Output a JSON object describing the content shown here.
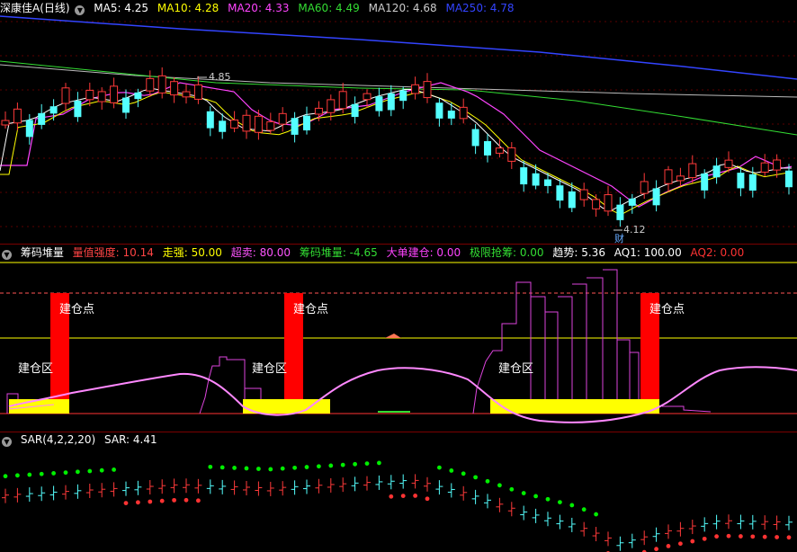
{
  "main": {
    "stock_name": "深康佳A",
    "period": "(日线)",
    "ma": [
      {
        "label": "MA5: 4.25",
        "color": "#ffffff"
      },
      {
        "label": "MA10: 4.28",
        "color": "#ffff00"
      },
      {
        "label": "MA20: 4.33",
        "color": "#ff44ff"
      },
      {
        "label": "MA60: 4.49",
        "color": "#33dd33"
      },
      {
        "label": "MA120: 4.68",
        "color": "#cccccc"
      },
      {
        "label": "MA250: 4.78",
        "color": "#3344ff"
      }
    ],
    "high_marker": "4.85",
    "low_marker": "4.12",
    "finance_badge": "财"
  },
  "indicator": {
    "name": "筹码堆量",
    "items": [
      {
        "label": "量值强度: 10.14",
        "color": "#ff4444"
      },
      {
        "label": "走强: 50.00",
        "color": "#ffff00"
      },
      {
        "label": "超卖: 80.00",
        "color": "#ff55ff"
      },
      {
        "label": "筹码堆量: -4.65",
        "color": "#33dd33"
      },
      {
        "label": "大单建仓: 0.00",
        "color": "#ff44ff"
      },
      {
        "label": "极限抢筹: 0.00",
        "color": "#33dd33"
      },
      {
        "label": "趋势: 5.36",
        "color": "#ffffff"
      },
      {
        "label": "AQ1: 100.00",
        "color": "#ffffff"
      },
      {
        "label": "AQ2: 0.00",
        "color": "#ff3333"
      }
    ],
    "build_point_label": "建仓点",
    "build_zone_label": "建仓区"
  },
  "sar": {
    "name": "SAR(4,2,2,20)",
    "value_label": "SAR: 4.41"
  },
  "colors": {
    "up": "#ff3a3a",
    "down": "#54ffff",
    "signal_red": "#ff0000",
    "signal_yellow": "#ffff00",
    "sar_up": "#00ee00",
    "sar_down": "#ff3333"
  }
}
